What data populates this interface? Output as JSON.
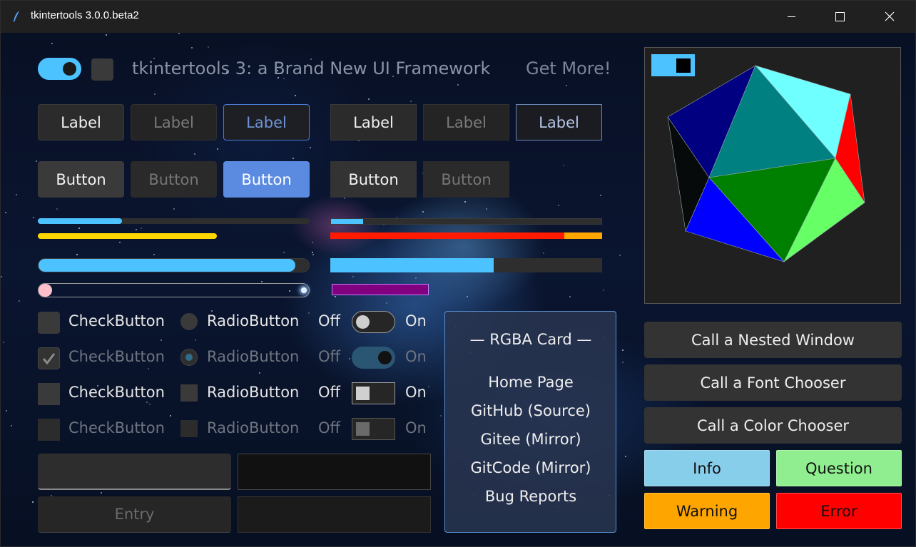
{
  "window": {
    "title": "tkintertools 3.0.0.beta2",
    "controls": [
      "minimize",
      "maximize",
      "close"
    ]
  },
  "header": {
    "headline": "tkintertools 3: a Brand New UI Framework",
    "link": "Get More!"
  },
  "labels": [
    "Label",
    "Label",
    "Label",
    "Label",
    "Label",
    "Label"
  ],
  "buttons": [
    "Button",
    "Button",
    "Button",
    "Button",
    "Button"
  ],
  "progress": {
    "thin_left_blue": 0.31,
    "thin_left_yellow": 0.66,
    "thin_right_blue": 0.12,
    "thin_right_red": 0.86,
    "thick_left_blue": 0.95,
    "thick_left_pink": 0.05,
    "thick_right_blue": 0.6
  },
  "checks": {
    "check_label": "CheckButton",
    "radio_label": "RadioButton",
    "off": "Off",
    "on": "On"
  },
  "entries": {
    "disabled_placeholder": "Entry"
  },
  "card": {
    "title": "— RGBA Card —",
    "links": [
      "Home Page",
      "GitHub (Source)",
      "Gitee (Mirror)",
      "GitCode (Mirror)",
      "Bug Reports"
    ]
  },
  "actions": {
    "nested_window": "Call a Nested Window",
    "font_chooser": "Call a Font Chooser",
    "color_chooser": "Call a Color Chooser",
    "info": "Info",
    "question": "Question",
    "warning": "Warning",
    "error": "Error"
  },
  "colors": {
    "accent": "#4cc2ff",
    "button_blue": "#5b8be0",
    "info": "#87ceeb",
    "question": "#90ee90",
    "warning": "#ffa500",
    "error": "#ff0000"
  }
}
